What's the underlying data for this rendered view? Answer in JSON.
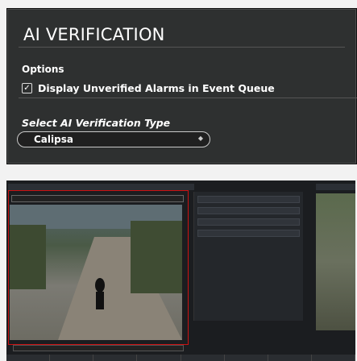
{
  "panel": {
    "title": "AI VERIFICATION",
    "options_heading": "Options",
    "checkbox_mark": "✓",
    "option_label": "Display Unverified Alarms in Event Queue",
    "select_heading": "Select AI Verification Type",
    "selected_value": "Calipsa"
  },
  "colors": {
    "panel_bg": "#2e3030",
    "text": "#ffffff",
    "alert_frame": "#cc1111"
  }
}
